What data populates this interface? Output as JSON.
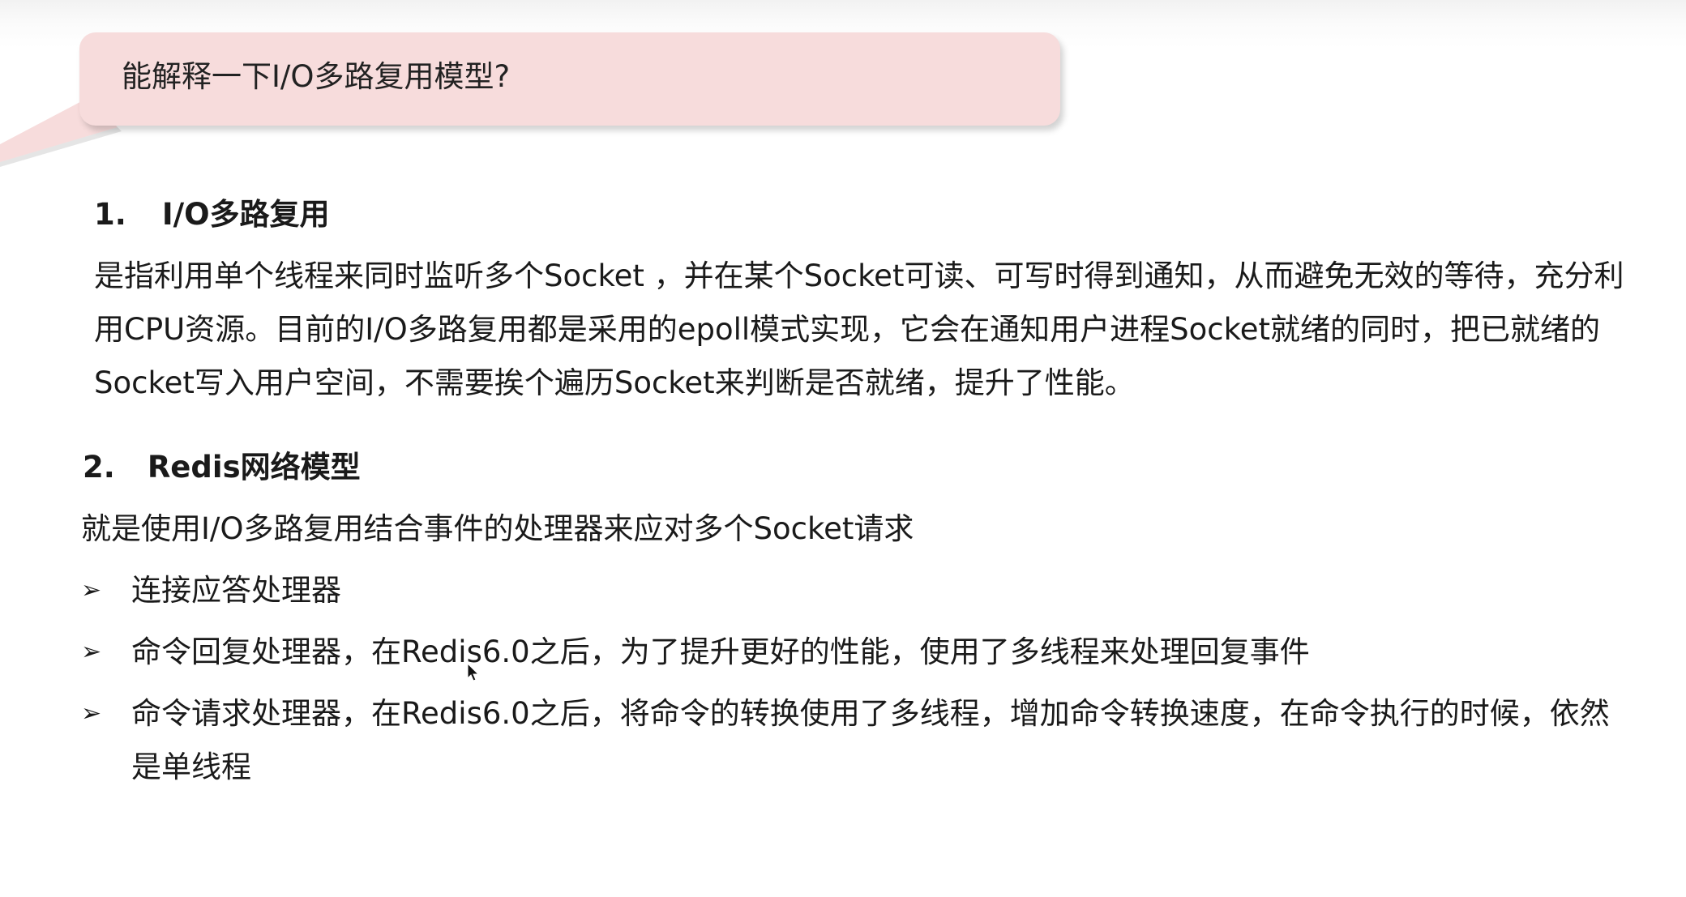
{
  "bubble": {
    "question": "能解释一下I/O多路复用模型?"
  },
  "section1": {
    "number": "1.",
    "title": "I/O多路复用",
    "lines": [
      "是指利用单个线程来同时监听多个Socket ，并在某个Socket可读、可写时得到通知，从而避免无效的等待，充分利",
      "用CPU资源。目前的I/O多路复用都是采用的epoll模式实现，它会在通知用户进程Socket就绪的同时，把已就绪的",
      "Socket写入用户空间，不需要挨个遍历Socket来判断是否就绪，提升了性能。"
    ]
  },
  "section2": {
    "number": "2.",
    "title": "Redis网络模型",
    "intro": "就是使用I/O多路复用结合事件的处理器来应对多个Socket请求",
    "bullets": [
      {
        "marker": "➢",
        "lines": [
          "连接应答处理器"
        ]
      },
      {
        "marker": "➢",
        "lines": [
          "命令回复处理器，在Redis6.0之后，为了提升更好的性能，使用了多线程来处理回复事件"
        ]
      },
      {
        "marker": "➢",
        "lines": [
          "命令请求处理器，在Redis6.0之后，将命令的转换使用了多线程，增加命令转换速度，在命令执行的时候，依然",
          "是单线程"
        ]
      }
    ]
  },
  "colors": {
    "bubble_fill": "#f7dcdc",
    "text": "#1a1a1a"
  }
}
